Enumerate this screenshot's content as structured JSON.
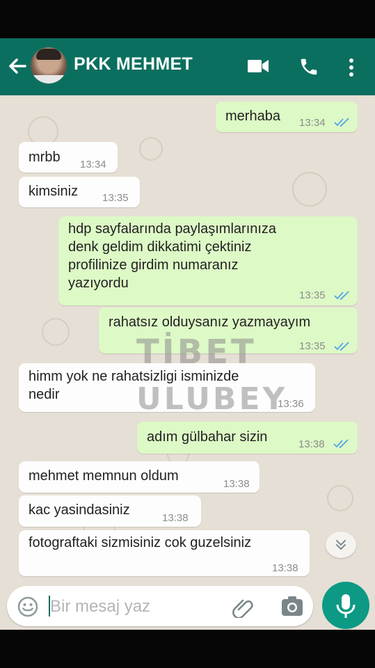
{
  "header": {
    "contact_name": "PKK MEHMET",
    "icons": [
      "back-arrow-icon",
      "video-call-icon",
      "phone-icon",
      "more-vert-icon"
    ]
  },
  "messages": [
    {
      "dir": "out",
      "text": "merhaba",
      "time": "13:34",
      "status": "read"
    },
    {
      "dir": "in",
      "text": "mrbb",
      "time": "13:34"
    },
    {
      "dir": "in",
      "text": "kimsiniz",
      "time": "13:35"
    },
    {
      "dir": "out",
      "text": "hdp sayfalarında paylaşımlarınıza\ndenk geldim dikkatimi çektiniz\nprofilinize girdim numaranız\nyazıyordu",
      "time": "13:35",
      "status": "read"
    },
    {
      "dir": "out",
      "text": "rahatsız olduysanız yazmayayım",
      "time": "13:35",
      "status": "read"
    },
    {
      "dir": "in",
      "text": "himm yok ne rahatsizligi isminizde\nnedir",
      "time": "13:36"
    },
    {
      "dir": "out",
      "text": "adım gülbahar sizin",
      "time": "13:38",
      "status": "read"
    },
    {
      "dir": "in",
      "text": "mehmet memnun oldum",
      "time": "13:38"
    },
    {
      "dir": "in",
      "text": "kac yasindasiniz",
      "time": "13:38"
    },
    {
      "dir": "in",
      "text": "fotograftaki sizmisiniz cok guzelsiniz",
      "time": "13:38"
    }
  ],
  "watermark": {
    "line1": "TİBET",
    "line2": "ULUBEY"
  },
  "composer": {
    "placeholder": "Bir mesaj yaz",
    "icons": [
      "emoji-icon",
      "attach-icon",
      "camera-icon",
      "mic-icon"
    ]
  },
  "colors": {
    "header": "#0b6f5f",
    "outgoing": "#ddf9c6",
    "incoming": "#fdfdfd",
    "tick": "#4fa5e6",
    "mic": "#0c9a85"
  }
}
